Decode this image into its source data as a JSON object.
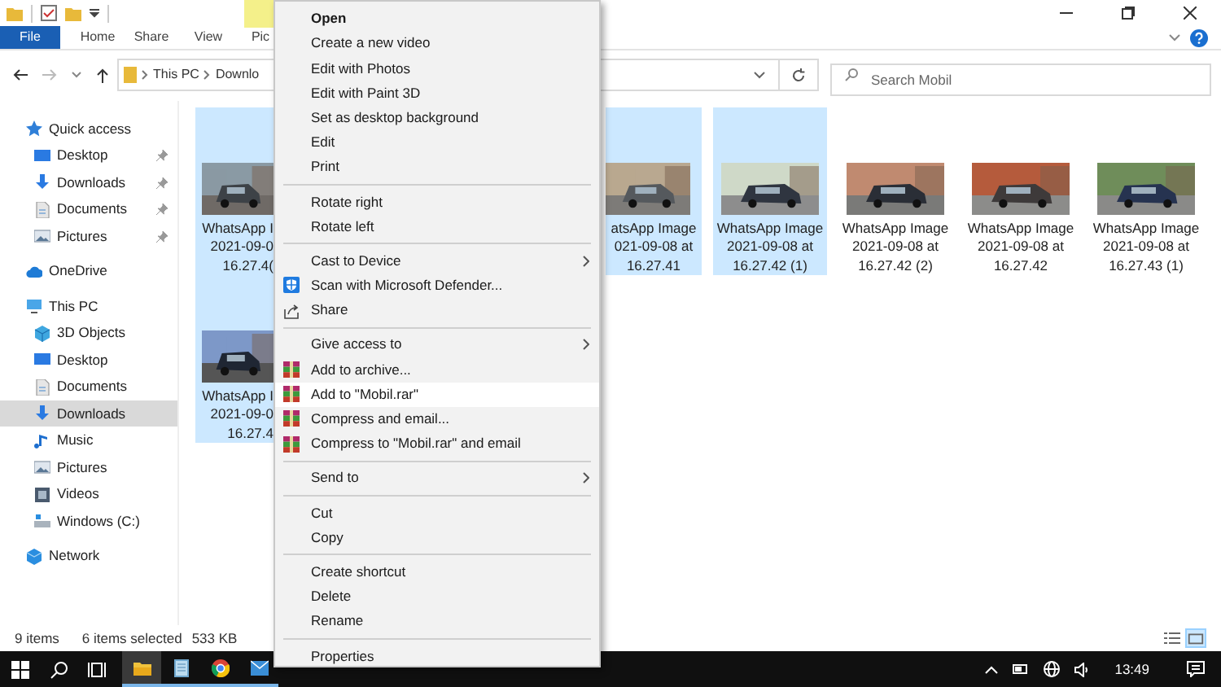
{
  "ribbon": {
    "tabs": [
      {
        "label": "File",
        "kind": "file",
        "selected": false
      },
      {
        "label": "Home",
        "kind": "tab",
        "selected": false
      },
      {
        "label": "Share",
        "kind": "tab",
        "selected": false
      },
      {
        "label": "View",
        "kind": "tab",
        "selected": false
      },
      {
        "label": "Pic",
        "kind": "tab",
        "selected": false
      }
    ]
  },
  "address_bar": {
    "crumbs": [
      "This PC",
      "Downlo"
    ]
  },
  "search": {
    "placeholder": "Search Mobil"
  },
  "navigation": [
    {
      "label": "Quick access",
      "kind": "star",
      "selected": false,
      "children": [
        {
          "label": "Desktop",
          "kind": "desktop",
          "selected": false,
          "pinned": true
        },
        {
          "label": "Downloads",
          "kind": "download",
          "selected": false,
          "pinned": true
        },
        {
          "label": "Documents",
          "kind": "document",
          "selected": false,
          "pinned": true
        },
        {
          "label": "Pictures",
          "kind": "pictures",
          "selected": false,
          "pinned": true
        }
      ]
    },
    {
      "label": "OneDrive",
      "kind": "cloud",
      "selected": false
    },
    {
      "label": "This PC",
      "kind": "pc",
      "selected": false,
      "children": [
        {
          "label": "3D Objects",
          "kind": "cube",
          "selected": false,
          "pinned": false
        },
        {
          "label": "Desktop",
          "kind": "desktop",
          "selected": false,
          "pinned": false
        },
        {
          "label": "Documents",
          "kind": "document",
          "selected": false,
          "pinned": false
        },
        {
          "label": "Downloads",
          "kind": "download",
          "selected": true,
          "pinned": false
        },
        {
          "label": "Music",
          "kind": "music",
          "selected": false,
          "pinned": false
        },
        {
          "label": "Pictures",
          "kind": "pictures",
          "selected": false,
          "pinned": false
        },
        {
          "label": "Videos",
          "kind": "videos",
          "selected": false,
          "pinned": false
        },
        {
          "label": "Windows (C:)",
          "kind": "drive",
          "selected": false,
          "pinned": false
        }
      ]
    },
    {
      "label": "Network",
      "kind": "network",
      "selected": false
    }
  ],
  "file_rows": [
    [
      {
        "lines": [
          "WhatsApp I",
          "2021-09-0",
          "16.27.4("
        ],
        "selected": true
      },
      {
        "lines": [
          "atsApp Image",
          "021-09-08 at",
          "16.27.41"
        ],
        "selected": true
      },
      {
        "lines": [
          "WhatsApp Image",
          "2021-09-08 at",
          "16.27.42 (1)"
        ],
        "selected": true
      },
      {
        "lines": [
          "WhatsApp Image",
          "2021-09-08 at",
          "16.27.42 (2)"
        ],
        "selected": false
      },
      {
        "lines": [
          "WhatsApp Image",
          "2021-09-08 at",
          "16.27.42"
        ],
        "selected": false
      },
      {
        "lines": [
          "WhatsApp Image",
          "2021-09-08 at",
          "16.27.43 (1)"
        ],
        "selected": false
      }
    ],
    [
      {
        "lines": [
          "WhatsApp I",
          "2021-09-0",
          "16.27.4"
        ],
        "selected": true
      }
    ]
  ],
  "context_menu": {
    "groups": [
      [
        {
          "label": "Open",
          "default": true,
          "selected": false
        },
        {
          "label": "Create a new video",
          "default": false,
          "selected": false
        },
        {
          "label": "Edit with Photos",
          "default": false,
          "selected": false
        },
        {
          "label": "Edit with Paint 3D",
          "default": false,
          "selected": false
        },
        {
          "label": "Set as desktop background",
          "default": false,
          "selected": false
        },
        {
          "label": "Edit",
          "default": false,
          "selected": false
        },
        {
          "label": "Print",
          "default": false,
          "selected": false
        }
      ],
      [
        {
          "label": "Rotate right",
          "default": false,
          "selected": false
        },
        {
          "label": "Rotate left",
          "default": false,
          "selected": false
        }
      ],
      [
        {
          "label": "Cast to Device",
          "default": false,
          "selected": false,
          "submenu": true
        },
        {
          "label": "Scan with Microsoft Defender...",
          "default": false,
          "selected": false,
          "kind": "shield"
        },
        {
          "label": "Share",
          "default": false,
          "selected": false,
          "kind": "share"
        }
      ],
      [
        {
          "label": "Give access to",
          "default": false,
          "selected": false,
          "submenu": true
        },
        {
          "label": "Add to archive...",
          "default": false,
          "selected": false,
          "kind": "archive"
        },
        {
          "label": "Add to \"Mobil.rar\"",
          "default": false,
          "selected": true,
          "kind": "archive"
        },
        {
          "label": "Compress and email...",
          "default": false,
          "selected": false,
          "kind": "archive"
        },
        {
          "label": "Compress to \"Mobil.rar\" and email",
          "default": false,
          "selected": false,
          "kind": "archive"
        }
      ],
      [
        {
          "label": "Send to",
          "default": false,
          "selected": false,
          "submenu": true
        }
      ],
      [
        {
          "label": "Cut",
          "default": false,
          "selected": false
        },
        {
          "label": "Copy",
          "default": false,
          "selected": false
        }
      ],
      [
        {
          "label": "Create shortcut",
          "default": false,
          "selected": false
        },
        {
          "label": "Delete",
          "default": false,
          "selected": false
        },
        {
          "label": "Rename",
          "default": false,
          "selected": false
        }
      ],
      [
        {
          "label": "Properties",
          "default": false,
          "selected": false
        }
      ]
    ]
  },
  "status_bar": {
    "item_count": "9 items",
    "selection": "6 items selected",
    "size": "533 KB",
    "views": [
      {
        "kind": "details",
        "selected": false
      },
      {
        "kind": "large_icons",
        "selected": true
      }
    ]
  },
  "taskbar": {
    "apps": [
      {
        "kind": "explorer",
        "active": true
      },
      {
        "kind": "notes",
        "active": false
      },
      {
        "kind": "browser",
        "active": false
      },
      {
        "kind": "mail",
        "active": false
      }
    ],
    "clock": "13:49"
  }
}
